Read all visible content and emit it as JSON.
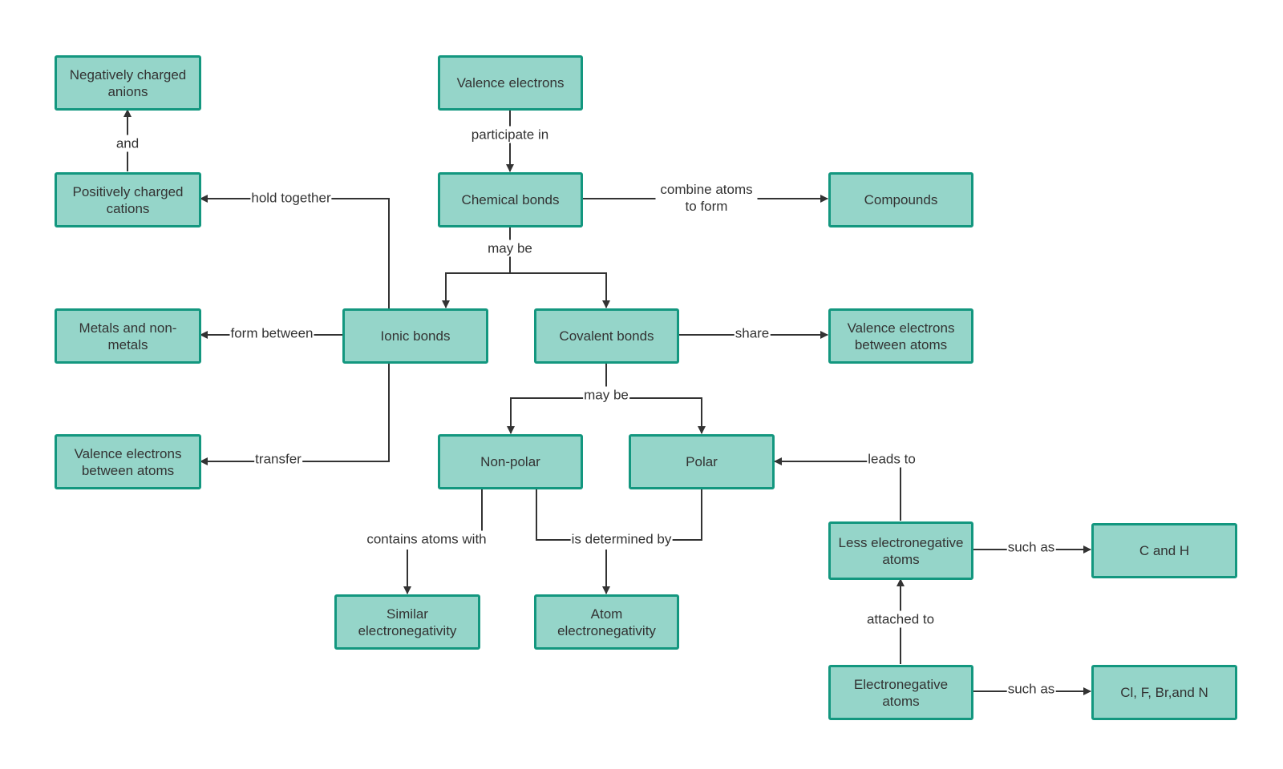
{
  "colors": {
    "node_fill": "#95d5c9",
    "node_border": "#13977f",
    "edge": "#333333",
    "text": "#333333"
  },
  "nodes": {
    "anions": "Negatively charged anions",
    "cations": "Positively charged cations",
    "valence": "Valence electrons",
    "chem": "Chemical bonds",
    "compounds": "Compounds",
    "metals": "Metals and non-metals",
    "ionic": "Ionic bonds",
    "covalent": "Covalent bonds",
    "share_target": "Valence electrons between atoms",
    "transfer_target": "Valence electrons between atoms",
    "nonpolar": "Non-polar",
    "polar": "Polar",
    "lessneg": "Less electronegative atoms",
    "candh": "C and H",
    "similar": "Similar electronegativity",
    "atomneg": "Atom electronegativity",
    "electroneg": "Electronegative atoms",
    "clfbrn": "Cl, F, Br,and N"
  },
  "edges": {
    "and": "and",
    "participate_in": "participate in",
    "hold_together": "hold together",
    "combine": "combine atoms to form",
    "may_be_1": "may be",
    "form_between": "form between",
    "share": "share",
    "transfer": "transfer",
    "may_be_2": "may be",
    "leads_to": "leads to",
    "contains": "contains atoms with",
    "determined": "is determined by",
    "such_as_1": "such as",
    "attached_to": "attached to",
    "such_as_2": "such as"
  }
}
